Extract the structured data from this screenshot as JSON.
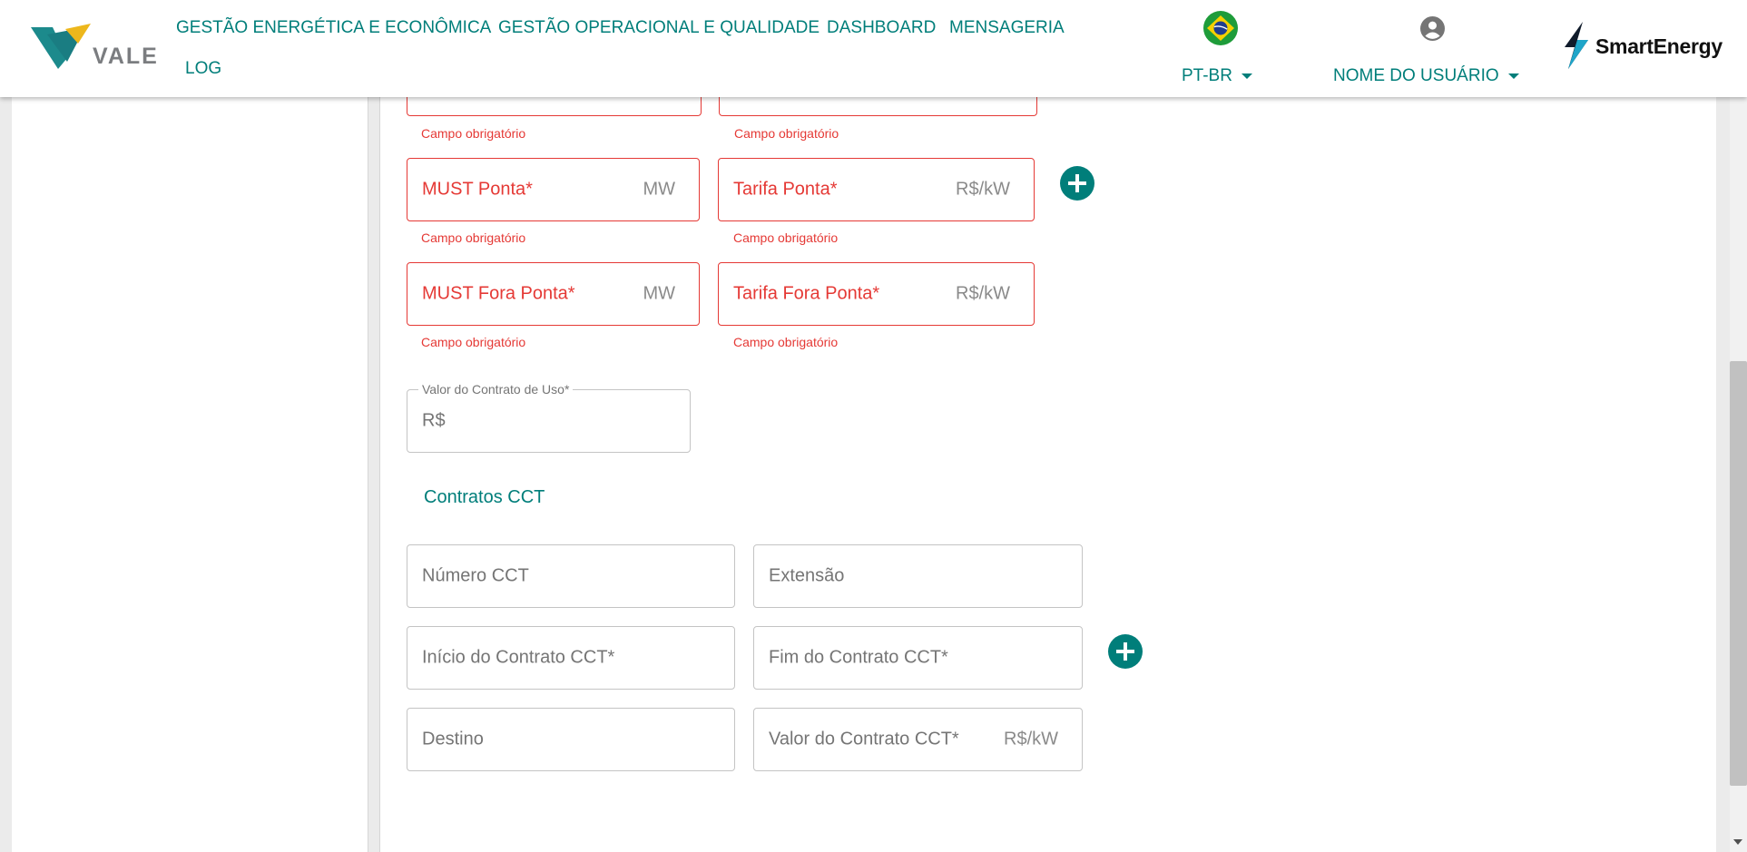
{
  "header": {
    "logo_text": "VALE",
    "nav": [
      {
        "label": "GESTÃO ENERGÉTICA E ECONÔMICA"
      },
      {
        "label": "GESTÃO OPERACIONAL E QUALIDADE"
      },
      {
        "label": "DASHBOARD"
      },
      {
        "label": "MENSAGERIA"
      },
      {
        "label": "LOG"
      }
    ],
    "language": "PT-BR",
    "user_name": "NOME DO USUÁRIO",
    "brand": "SmartEnergy"
  },
  "form": {
    "helper_text": "Campo obrigatório",
    "must_ponta": {
      "label": "MUST Ponta*",
      "unit": "MW"
    },
    "tarifa_ponta": {
      "label": "Tarifa Ponta*",
      "unit": "R$/kW"
    },
    "must_fora_ponta": {
      "label": "MUST Fora Ponta*",
      "unit": "MW"
    },
    "tarifa_fora_ponta": {
      "label": "Tarifa Fora Ponta*",
      "unit": "R$/kW"
    },
    "valor_contrato_uso": {
      "label": "Valor do Contrato de Uso*",
      "prefix": "R$"
    },
    "cct_section_title": "Contratos CCT",
    "numero_cct": {
      "placeholder": "Número CCT"
    },
    "extensao": {
      "placeholder": "Extensão"
    },
    "inicio_cct": {
      "placeholder": "Início do Contrato CCT*"
    },
    "fim_cct": {
      "placeholder": "Fim do Contrato CCT*"
    },
    "destino": {
      "placeholder": "Destino"
    },
    "valor_cct": {
      "placeholder": "Valor do Contrato CCT*",
      "unit": "R$/kW"
    }
  },
  "colors": {
    "primary": "#007e7a",
    "error": "#e53935",
    "background": "#ebebeb"
  }
}
